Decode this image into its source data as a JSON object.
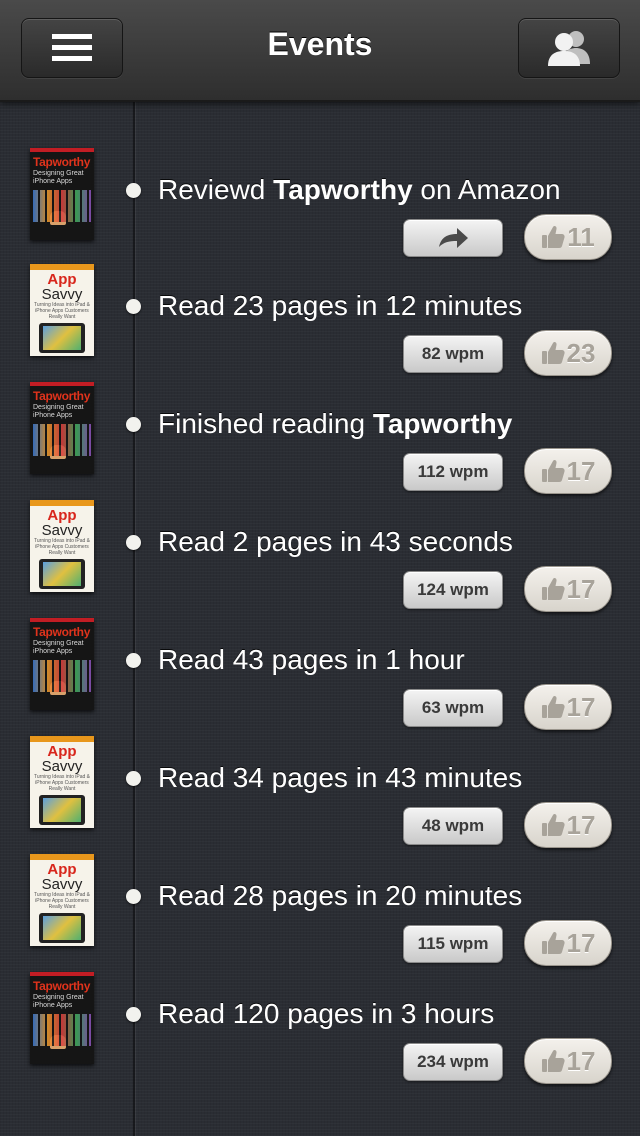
{
  "navbar": {
    "title": "Events",
    "menu_icon": "menu-icon",
    "friends_icon": "people-icon"
  },
  "events": [
    {
      "book": "tapworthy",
      "text_pre": "Reviewd ",
      "text_bold": "Tapworthy",
      "text_post": " on Amazon",
      "action": "share-icon",
      "likes": "11"
    },
    {
      "book": "appsavvy",
      "text_pre": "Read 23 pages in 12 minutes",
      "text_bold": "",
      "text_post": "",
      "action_label": "82 wpm",
      "likes": "23"
    },
    {
      "book": "tapworthy",
      "text_pre": "Finished reading ",
      "text_bold": "Tapworthy",
      "text_post": "",
      "action_label": "112 wpm",
      "likes": "17"
    },
    {
      "book": "appsavvy",
      "text_pre": "Read 2 pages in 43 seconds",
      "text_bold": "",
      "text_post": "",
      "action_label": "124 wpm",
      "likes": "17"
    },
    {
      "book": "tapworthy",
      "text_pre": "Read 43 pages in 1 hour",
      "text_bold": "",
      "text_post": "",
      "action_label": "63 wpm",
      "likes": "17"
    },
    {
      "book": "appsavvy",
      "text_pre": "Read 34 pages in 43 minutes",
      "text_bold": "",
      "text_post": "",
      "action_label": "48 wpm",
      "likes": "17"
    },
    {
      "book": "appsavvy",
      "text_pre": "Read 28 pages in 20 minutes",
      "text_bold": "",
      "text_post": "",
      "action_label": "115 wpm",
      "likes": "17"
    },
    {
      "book": "tapworthy",
      "text_pre": "Read 120 pages in 3 hours",
      "text_bold": "",
      "text_post": "",
      "action_label": "234 wpm",
      "likes": "17"
    }
  ],
  "covers": {
    "tapworthy": {
      "title": "Tapworthy",
      "subtitle": "Designing Great iPhone Apps"
    },
    "appsavvy": {
      "title_line1": "App",
      "title_line2": "Savvy",
      "subtitle": "Turning Ideas into iPad & iPhone Apps Customers Really Want"
    }
  },
  "colors": {
    "background": "#2a2d33",
    "navbar": "#3a3a3a",
    "tapworthy_red": "#e0331c",
    "appsavvy_red": "#d8261c",
    "like_text": "#a8a39a"
  }
}
